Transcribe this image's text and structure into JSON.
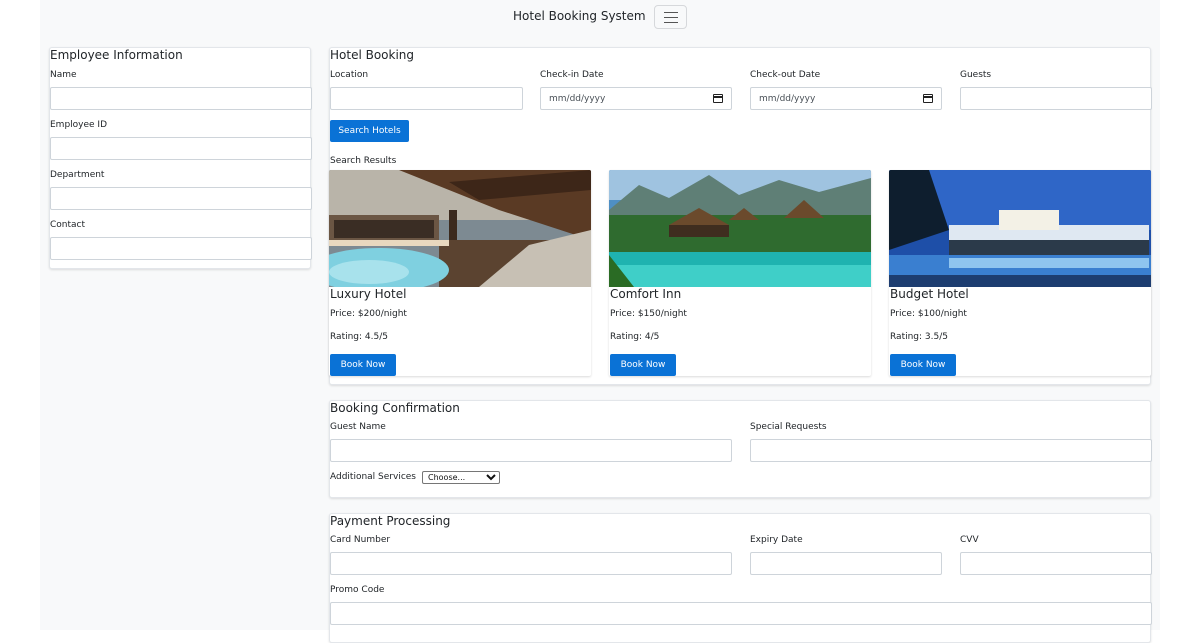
{
  "header": {
    "title": "Hotel Booking System",
    "menu_icon": "hamburger-icon"
  },
  "employee": {
    "title": "Employee Information",
    "fields": [
      {
        "label": "Name",
        "value": ""
      },
      {
        "label": "Employee ID",
        "value": ""
      },
      {
        "label": "Department",
        "value": ""
      },
      {
        "label": "Contact",
        "value": ""
      }
    ]
  },
  "booking": {
    "title": "Hotel Booking",
    "location_label": "Location",
    "checkin_label": "Check-in Date",
    "checkin_placeholder": "mm/dd/yyyy",
    "checkout_label": "Check-out Date",
    "checkout_placeholder": "mm/dd/yyyy",
    "guests_label": "Guests",
    "search_button": "Search Hotels",
    "results_label": "Search Results",
    "hotels": [
      {
        "name": "Luxury Hotel",
        "price": "Price: $200/night",
        "rating": "Rating: 4.5/5",
        "button": "Book Now"
      },
      {
        "name": "Comfort Inn",
        "price": "Price: $150/night",
        "rating": "Rating: 4/5",
        "button": "Book Now"
      },
      {
        "name": "Budget Hotel",
        "price": "Price: $100/night",
        "rating": "Rating: 3.5/5",
        "button": "Book Now"
      }
    ]
  },
  "confirmation": {
    "title": "Booking Confirmation",
    "guest_name_label": "Guest Name",
    "special_requests_label": "Special Requests",
    "services_label": "Additional Services",
    "services_selected": "Choose..."
  },
  "payment": {
    "title": "Payment Processing",
    "card_label": "Card Number",
    "expiry_label": "Expiry Date",
    "cvv_label": "CVV",
    "promo_label": "Promo Code"
  },
  "colors": {
    "primary": "#0a72d6",
    "page_bg": "#f8f9fa"
  }
}
